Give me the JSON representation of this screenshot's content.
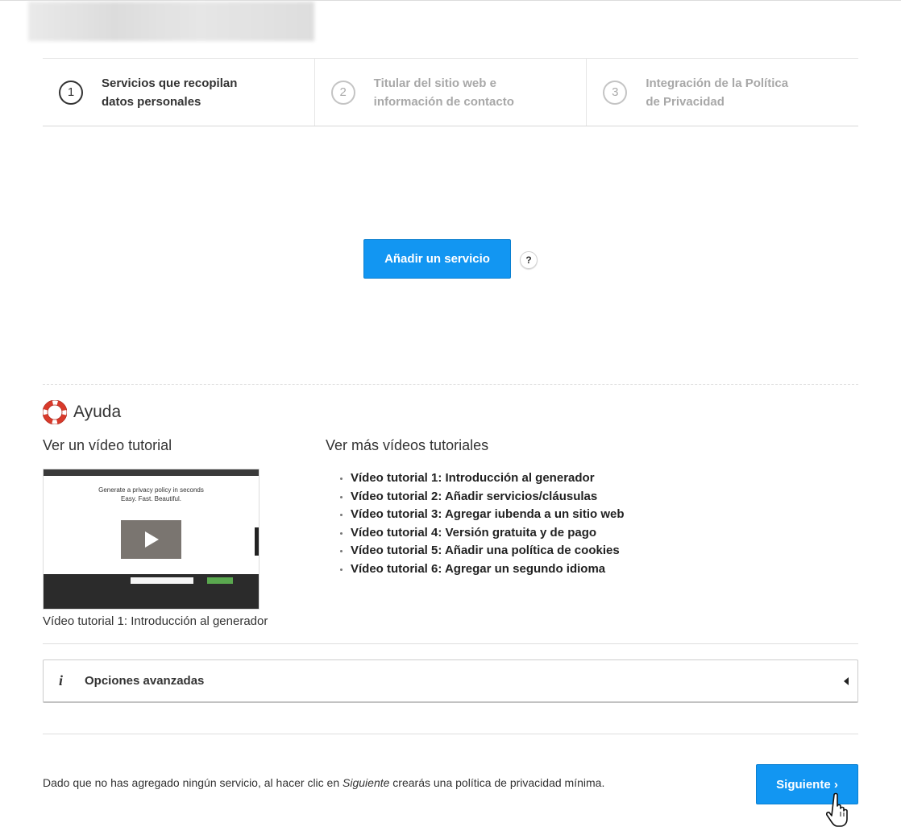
{
  "icons": {
    "lifebuoy": "lifebuoy-icon",
    "help": "question-icon",
    "info": "info-icon",
    "caret": "caret-left-icon",
    "play": "play-icon",
    "cursor": "hand-pointer-icon"
  },
  "colors": {
    "primary": "#1296f2",
    "text": "#333333",
    "inactive": "#a8a8a8"
  },
  "steps": [
    {
      "number": "1",
      "line1": "Servicios que recopilan",
      "line2": "datos personales",
      "active": true
    },
    {
      "number": "2",
      "line1": "Titular del sitio web e",
      "line2": "información de contacto",
      "active": false
    },
    {
      "number": "3",
      "line1": "Integración de la Política",
      "line2": "de Privacidad",
      "active": false
    }
  ],
  "services": {
    "add_button": "Añadir un servicio",
    "help_symbol": "?"
  },
  "help": {
    "title": "Ayuda",
    "video_heading": "Ver un vídeo tutorial",
    "more_heading": "Ver más vídeos tutoriales",
    "thumbnail": {
      "line1": "Generate a privacy policy in seconds",
      "line2": "Easy. Fast. Beautiful."
    },
    "video_caption": "Vídeo tutorial 1: Introducción al generador",
    "tutorials": [
      "Vídeo tutorial 1: Introducción al generador",
      "Vídeo tutorial 2: Añadir servicios/cláusulas",
      "Vídeo tutorial 3: Agregar iubenda a un sitio web",
      "Vídeo tutorial 4: Versión gratuita y de pago",
      "Vídeo tutorial 5: Añadir una política de cookies",
      "Vídeo tutorial 6: Agregar un segundo idioma"
    ]
  },
  "advanced": {
    "icon_glyph": "i",
    "label": "Opciones avanzadas"
  },
  "footer": {
    "note_before": "Dado que no has agregado ningún servicio, al hacer clic en ",
    "note_emphasis": "Siguiente",
    "note_after": " crearás una política de privacidad mínima.",
    "next_button": "Siguiente ›"
  }
}
